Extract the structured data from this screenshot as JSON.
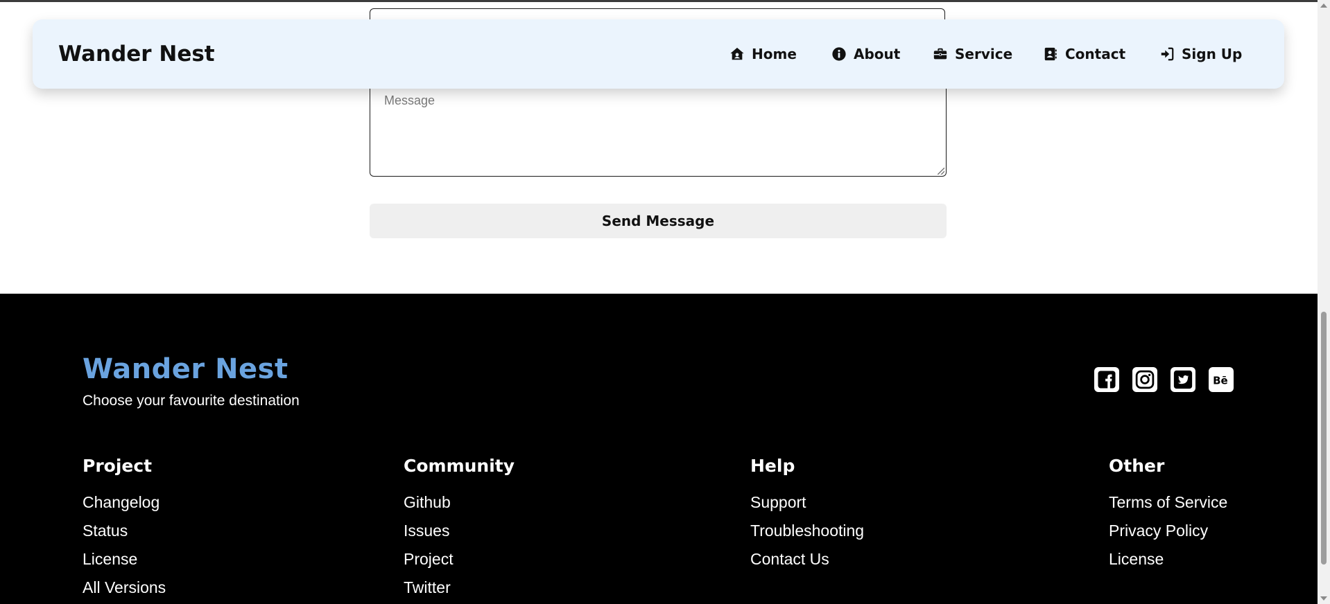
{
  "form": {
    "message_placeholder": "Message",
    "send_label": "Send Message"
  },
  "navbar": {
    "brand": "Wander Nest",
    "items": [
      {
        "label": "Home",
        "icon": "house-user-icon"
      },
      {
        "label": "About",
        "icon": "info-circle-icon"
      },
      {
        "label": "Service",
        "icon": "briefcase-icon"
      },
      {
        "label": "Contact",
        "icon": "address-book-icon"
      },
      {
        "label": "Sign Up",
        "icon": "sign-in-icon"
      }
    ]
  },
  "footer": {
    "brand": "Wander Nest",
    "tagline": "Choose your favourite destination",
    "brand_color": "#6aa3df",
    "social": [
      "facebook-icon",
      "instagram-icon",
      "twitter-icon",
      "behance-icon"
    ],
    "columns": [
      {
        "heading": "Project",
        "links": [
          "Changelog",
          "Status",
          "License",
          "All Versions"
        ]
      },
      {
        "heading": "Community",
        "links": [
          "Github",
          "Issues",
          "Project",
          "Twitter"
        ]
      },
      {
        "heading": "Help",
        "links": [
          "Support",
          "Troubleshooting",
          "Contact Us"
        ]
      },
      {
        "heading": "Other",
        "links": [
          "Terms of Service",
          "Privacy Policy",
          "License"
        ]
      }
    ]
  }
}
